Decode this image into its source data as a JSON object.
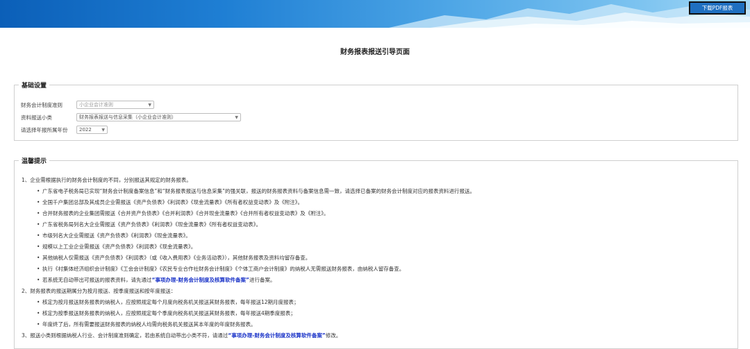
{
  "header": {
    "pdf_button": "下载PDF报表"
  },
  "page_title": "财务报表报送引导页面",
  "basic_settings": {
    "legend": "基础设置",
    "fields": [
      {
        "label": "财务会计制度准则",
        "value": "小企业会计准则"
      },
      {
        "label": "资料报送小类",
        "value": "财务报表报送与信息采集（小企业会计准则）"
      },
      {
        "label": "请选择年报所属年份",
        "value": "2022"
      }
    ]
  },
  "tips": {
    "legend": "温馨提示",
    "p1": "1、企业需根据执行的财务会计制度的不同，分别报送其规定的财务报表。",
    "p1_items": [
      "广东省电子税务局已实现“财务会计制度备案信息”和“财务报表报送与信息采集”的强关联，报送的财务报表资料与备案信息需一致，请选择已备案的财务会计制度对应的报表资料进行报送。",
      "全国千户集团总部及其成员企业需报送《资产负债表》《利润表》《现金流量表》《所有者权益变动表》及《附注》。",
      "合并财务报表的企业集团需报送《合并资产负债表》《合并利润表》《合并现金流量表》《合并所有者权益变动表》及《附注》。",
      "广东省税务局列名大企业需报送《资产负债表》《利润表》《现金流量表》《所有者权益变动表》。",
      "市级列名大企业需报送《资产负债表》《利润表》《现金流量表》。",
      "规模以上工业企业需报送《资产负债表》《利润表》《现金流量表》。",
      "其他纳税人仅需报送《资产负债表》《利润表》（或《收入费用表》《业务活动表》），其他财务报表及资料均留存备查。",
      "执行《村集体经济组织会计制度》《工会会计制度》《农民专业合作社财务会计制度》《个体工商户会计制度》的纳税人无需报送财务报表，由纳税人留存备查。"
    ],
    "p1_last": {
      "pre": "若系统无自动带出可报送的报表资料，请先通过",
      "link": "“事项办理-财务会计制度及核算软件备案”",
      "post": "进行备案。"
    },
    "p2": "2、财务报表的报送期属分为按月报送、按季度报送和按年度报送：",
    "p2_items": [
      "核定为按月报送财务报表的纳税人，应按照规定每个月度向税务机关报送其财务报表，每年报送12期月度报表；",
      "核定为按季报送财务报表的纳税人，应按照规定每个季度向税务机关报送其财务报表，每年报送4期季度报表；",
      "年度终了后，所有需要报送财务报表的纳税人均需向税务机关报送其本年度的年度财务报表。"
    ],
    "p3": {
      "pre": "3、报送小类则根据纳税人行业、会计制度准则确定，若由系统自动带出小类不符，请通过",
      "link": "“事项办理-财务会计制度及核算软件备案”",
      "post": "修改。"
    }
  }
}
